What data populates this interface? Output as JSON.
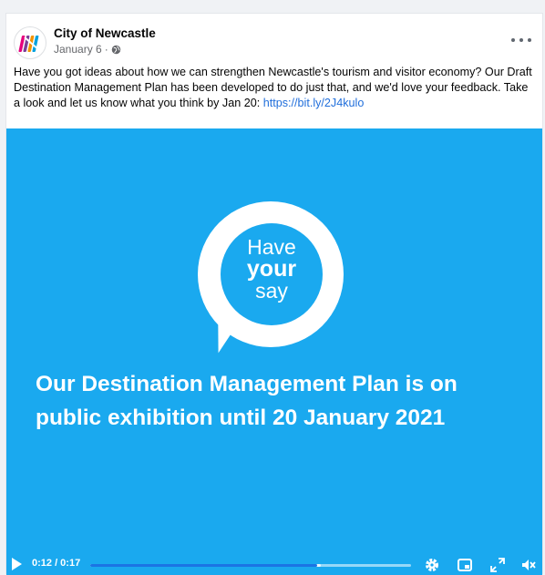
{
  "post": {
    "author": "City of Newcastle",
    "date": "January 6",
    "separator": "·",
    "text_main": "Have you got ideas about how we can strengthen Newcastle's tourism and visitor economy? Our Draft Destination Management Plan has been developed to do just that, and we'd love your feedback. Take a look and let us know what you think by Jan 20: ",
    "link": "https://bit.ly/2J4kulo",
    "icons": {
      "avatar": "city-of-newcastle-logo",
      "privacy": "globe-icon",
      "more": "more-options-icon"
    }
  },
  "video": {
    "bubble": {
      "line1": "Have",
      "line2": "your",
      "line3": "say"
    },
    "headline_line1": "Our Destination Management Plan is on",
    "headline_line2": "public exhibition until 20 January 2021",
    "background_color": "#1aa9ef",
    "controls": {
      "time": "0:12 / 0:17",
      "progress": 0.706,
      "icons": [
        "play-icon",
        "settings-icon",
        "picture-in-picture-icon",
        "fullscreen-icon",
        "muted-volume-icon"
      ]
    }
  }
}
